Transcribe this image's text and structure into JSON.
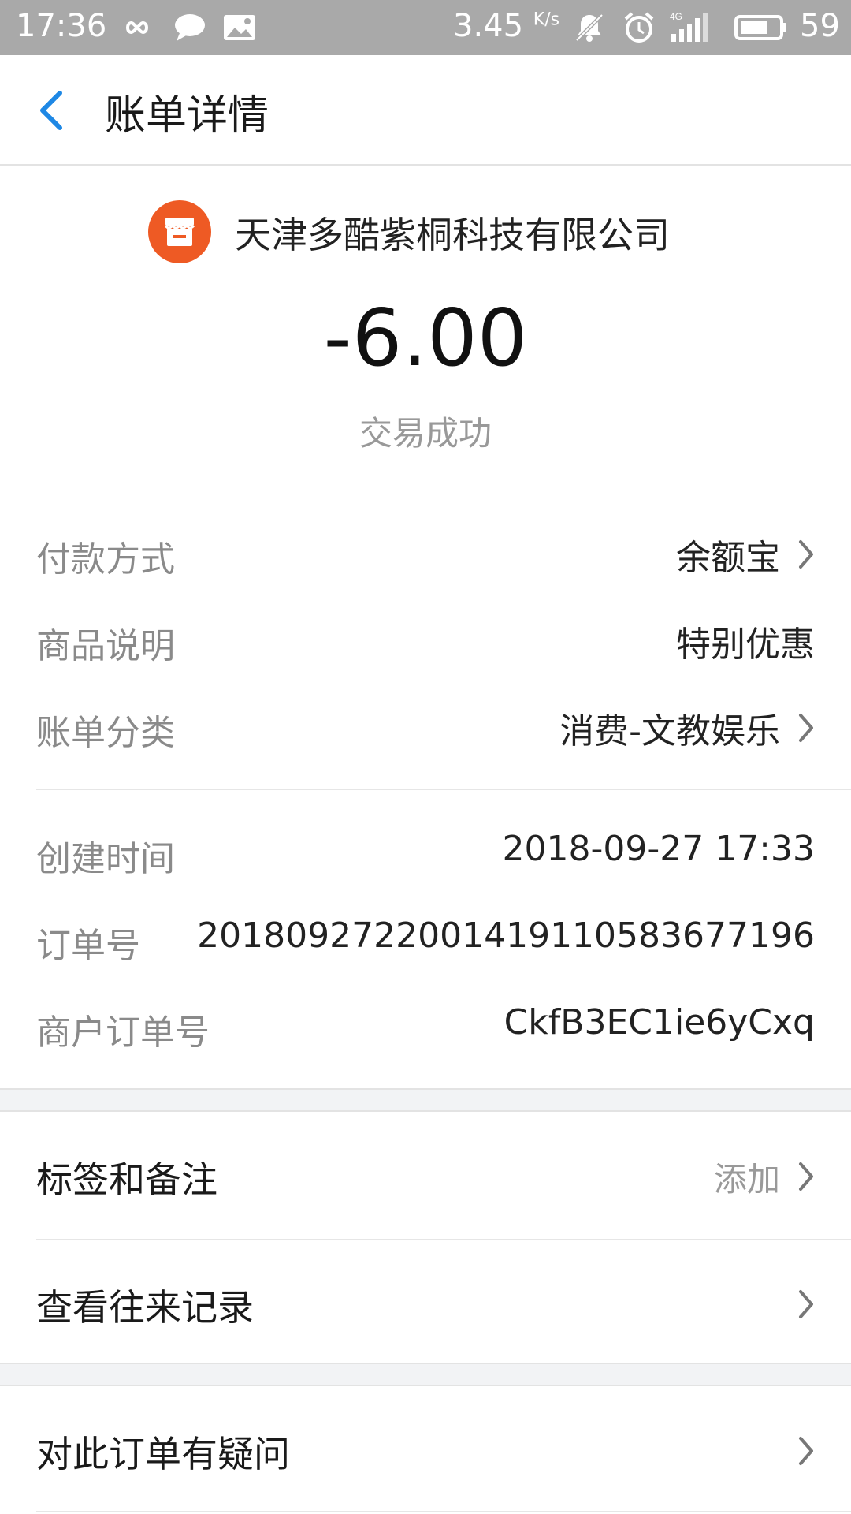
{
  "status_bar": {
    "time": "17:36",
    "net_speed": "3.45",
    "net_speed_unit": "K/s",
    "network": "4G",
    "battery": "59",
    "icons": [
      "infinity-icon",
      "chat-icon",
      "gallery-icon",
      "bell-muted-icon",
      "alarm-icon",
      "signal-icon",
      "battery-icon"
    ]
  },
  "header": {
    "title": "账单详情",
    "back_icon": "chevron-left-icon"
  },
  "merchant": {
    "name": "天津多酷紫桐科技有限公司",
    "logo_icon": "store-icon",
    "amount": "-6.00",
    "status": "交易成功"
  },
  "details": {
    "payment_method": {
      "label": "付款方式",
      "value": "余额宝"
    },
    "product_desc": {
      "label": "商品说明",
      "value": "特别优惠"
    },
    "category": {
      "label": "账单分类",
      "value": "消费-文教娱乐"
    },
    "created_time": {
      "label": "创建时间",
      "value": "2018-09-27 17:33"
    },
    "order_no": {
      "label": "订单号",
      "value": "2018092722001419110583677196"
    },
    "merchant_order_no": {
      "label": "商户订单号",
      "value": "CkfB3EC1ie6yCxq"
    }
  },
  "actions": {
    "tags_notes": {
      "label": "标签和备注",
      "hint": "添加"
    },
    "history": {
      "label": "查看往来记录"
    },
    "dispute": {
      "label": "对此订单有疑问"
    }
  },
  "colors": {
    "accent_blue": "#1e88e5",
    "logo_orange": "#ee5a24",
    "status_bar": "#a9a9a9"
  }
}
